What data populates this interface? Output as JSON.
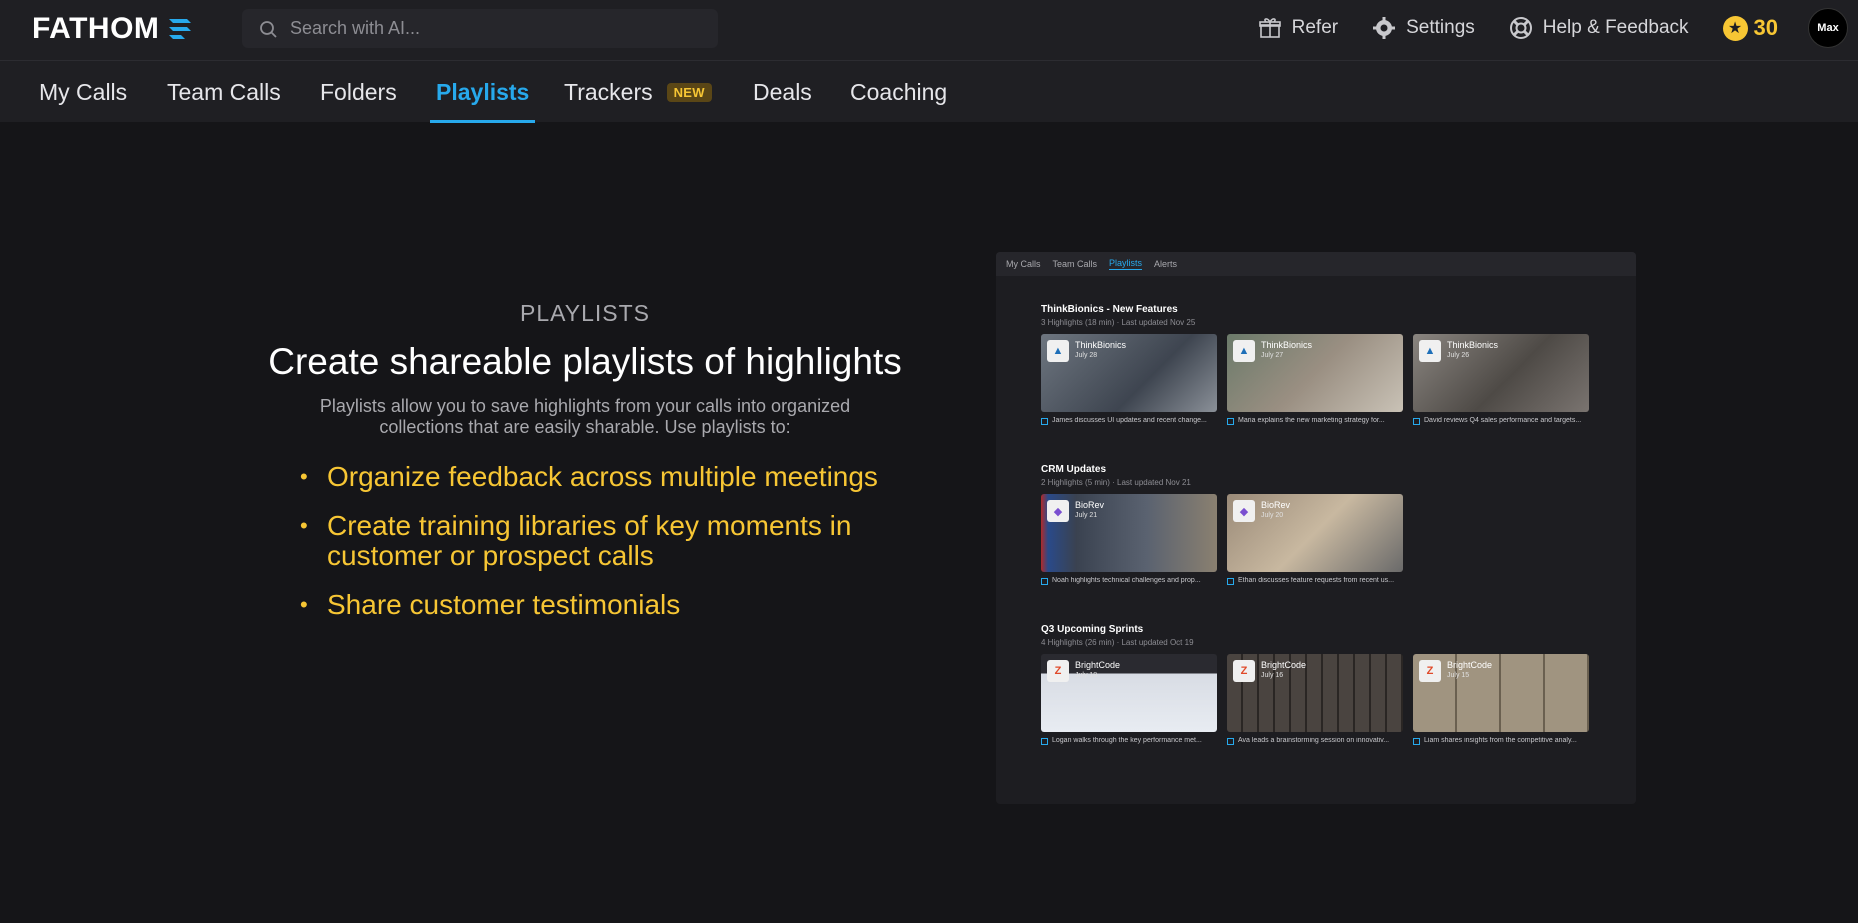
{
  "app": {
    "name": "FATHOM"
  },
  "search": {
    "placeholder": "Search with AI..."
  },
  "top_actions": {
    "refer": "Refer",
    "settings": "Settings",
    "help": "Help & Feedback",
    "coins": "30",
    "avatar": "Max"
  },
  "nav": {
    "items": [
      {
        "label": "My Calls"
      },
      {
        "label": "Team Calls"
      },
      {
        "label": "Folders"
      },
      {
        "label": "Playlists"
      },
      {
        "label": "Trackers",
        "badge": "NEW"
      },
      {
        "label": "Deals"
      },
      {
        "label": "Coaching"
      }
    ]
  },
  "hero": {
    "eyebrow": "PLAYLISTS",
    "headline": "Create shareable playlists of highlights",
    "description": "Playlists allow you to save highlights from your calls into organized collections that are easily sharable. Use playlists to:",
    "bullets": [
      "Organize feedback across multiple meetings",
      "Create training libraries of key moments in customer or prospect calls",
      "Share customer testimonials"
    ]
  },
  "preview": {
    "tabs": [
      "My Calls",
      "Team Calls",
      "Playlists",
      "Alerts"
    ],
    "sections": [
      {
        "title": "ThinkBionics - New Features",
        "meta": "3 Highlights (18 min)  ·  Last updated Nov 25",
        "cards": [
          {
            "company": "ThinkBionics",
            "date": "July 28",
            "caption": "James discusses UI updates and recent change..."
          },
          {
            "company": "ThinkBionics",
            "date": "July 27",
            "caption": "Maria explains the new marketing strategy for..."
          },
          {
            "company": "ThinkBionics",
            "date": "July 26",
            "caption": "David reviews Q4 sales performance and targets..."
          }
        ]
      },
      {
        "title": "CRM Updates",
        "meta": "2 Highlights (5 min)  ·  Last updated Nov 21",
        "cards": [
          {
            "company": "BioRev",
            "date": "July 21",
            "caption": "Noah highlights technical challenges and prop..."
          },
          {
            "company": "BioRev",
            "date": "July 20",
            "caption": "Ethan discusses feature requests from recent us..."
          }
        ]
      },
      {
        "title": "Q3 Upcoming Sprints",
        "meta": "4 Highlights (26 min)  ·  Last updated Oct 19",
        "cards": [
          {
            "company": "BrightCode",
            "date": "July 18",
            "caption": "Logan walks through the key performance met..."
          },
          {
            "company": "BrightCode",
            "date": "July 16",
            "caption": "Ava leads a brainstorming session on innovativ..."
          },
          {
            "company": "BrightCode",
            "date": "July 15",
            "caption": "Liam shares insights from the competitive analy..."
          }
        ]
      }
    ]
  },
  "colors": {
    "accent": "#27a9ec",
    "highlight": "#f7c634",
    "background": "#151518",
    "bar": "#1f1f23"
  }
}
